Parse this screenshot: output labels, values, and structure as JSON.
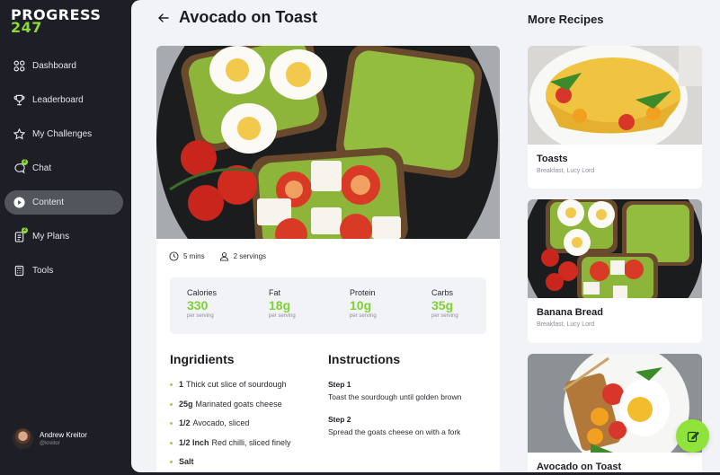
{
  "app": {
    "logo_line1": "PROGRESS",
    "logo_line2": "247",
    "accent_color": "#8dd93a"
  },
  "sidebar": {
    "items": [
      {
        "label": "Dashboard",
        "icon": "grid-icon",
        "active": false
      },
      {
        "label": "Leaderboard",
        "icon": "trophy-icon",
        "active": false
      },
      {
        "label": "My Challenges",
        "icon": "star-icon",
        "active": false
      },
      {
        "label": "Chat",
        "icon": "chat-icon",
        "active": false,
        "badge": "2"
      },
      {
        "label": "Content",
        "icon": "play-icon",
        "active": true
      },
      {
        "label": "My Plans",
        "icon": "clipboard-icon",
        "active": false,
        "badge": "2"
      },
      {
        "label": "Tools",
        "icon": "calculator-icon",
        "active": false
      }
    ],
    "user": {
      "name": "Andrew Kreitor",
      "handle": "@kreitor"
    }
  },
  "recipe": {
    "title": "Avocado on Toast",
    "time": "5 mins",
    "servings": "2 servings",
    "nutrition": [
      {
        "label": "Calories",
        "value": "330",
        "per": "per serving"
      },
      {
        "label": "Fat",
        "value": "18g",
        "per": "per serving"
      },
      {
        "label": "Protein",
        "value": "10g",
        "per": "per serving"
      },
      {
        "label": "Carbs",
        "value": "35g",
        "per": "per serving"
      }
    ],
    "ingredients_title": "Ingridients",
    "ingredients": [
      {
        "qty": "1",
        "text": "Thick cut slice of sourdough"
      },
      {
        "qty": "25g",
        "text": "Marinated goats cheese"
      },
      {
        "qty": "1/2",
        "text": "Avocado, sliced"
      },
      {
        "qty": "1/2 Inch",
        "text": "Red chilli, sliced finely"
      },
      {
        "qty": "Salt",
        "text": ""
      }
    ],
    "instructions_title": "Instructions",
    "steps": [
      {
        "title": "Step 1",
        "text": "Toast the sourdough until golden brown"
      },
      {
        "title": "Step 2",
        "text": "Spread the goats cheese on with a fork"
      }
    ]
  },
  "more": {
    "title": "More Recipes",
    "items": [
      {
        "title": "Toasts",
        "sub": "Breakfast, Lucy Lord"
      },
      {
        "title": "Banana Bread",
        "sub": "Breakfast, Lucy Lord"
      },
      {
        "title": "Avocado on Toast",
        "sub": ""
      }
    ]
  }
}
